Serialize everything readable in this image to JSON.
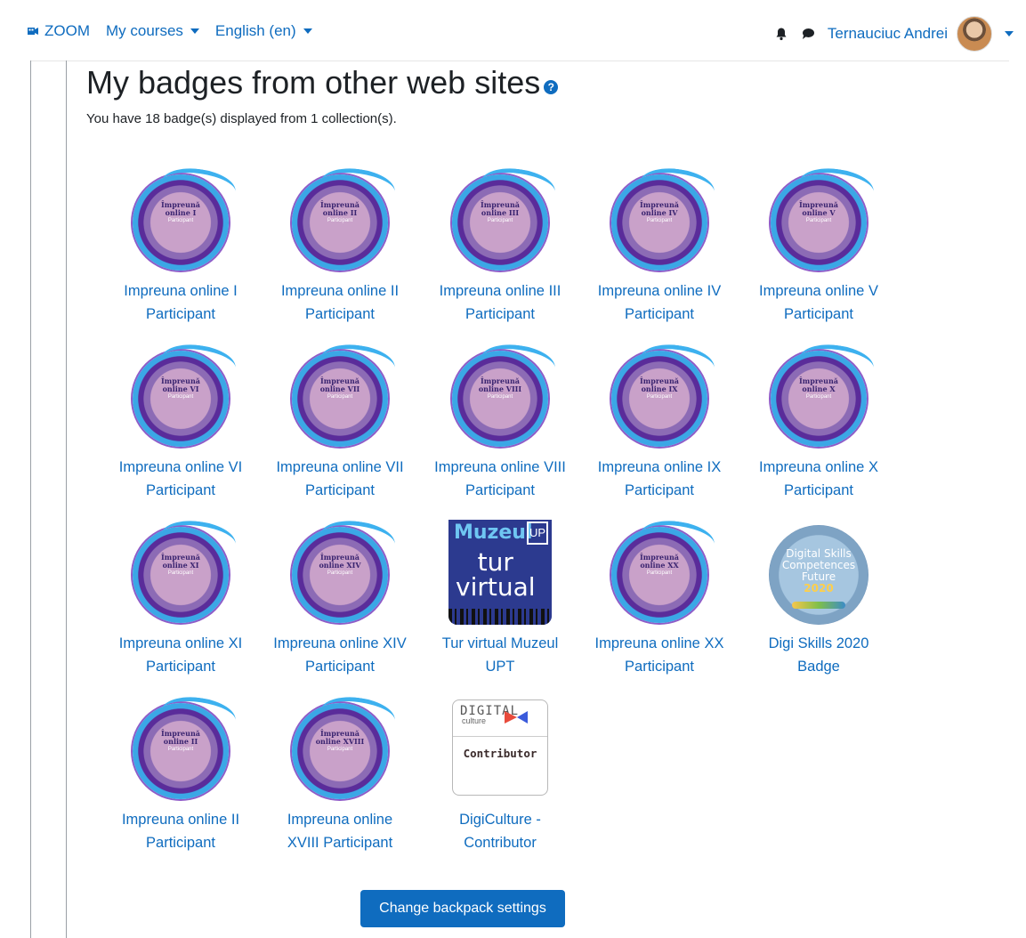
{
  "nav": {
    "zoom_label": "ZOOM",
    "my_courses_label": "My courses",
    "language_label": "English (en)",
    "user_name": "Ternauciuc Andrei"
  },
  "page": {
    "title": "My badges from other web sites",
    "summary": "You have 18 badge(s) displayed from 1 collection(s)."
  },
  "badge_image_text": {
    "impreuna": "Împreună",
    "online_prefix": "online",
    "participant": "Participant",
    "muzeul": "Muzeul",
    "up": "UP",
    "tur": "tur",
    "virtual": "virtual",
    "digital_skills": "Digital Skills",
    "competences": "Competences",
    "future": "Future",
    "year": "2020",
    "digital": "DIGITAL",
    "culture": "culture",
    "contributor": "Contributor"
  },
  "badges": [
    {
      "line1": "Impreuna online I",
      "line2": "Participant",
      "numeral": "I",
      "kind": "circle"
    },
    {
      "line1": "Impreuna online II",
      "line2": "Participant",
      "numeral": "II",
      "kind": "circle"
    },
    {
      "line1": "Impreuna online III",
      "line2": "Participant",
      "numeral": "III",
      "kind": "circle"
    },
    {
      "line1": "Impreuna online IV",
      "line2": "Participant",
      "numeral": "IV",
      "kind": "circle"
    },
    {
      "line1": "Impreuna online V",
      "line2": "Participant",
      "numeral": "V",
      "kind": "circle"
    },
    {
      "line1": "Impreuna online VI",
      "line2": "Participant",
      "numeral": "VI",
      "kind": "circle"
    },
    {
      "line1": "Impreuna online VII",
      "line2": "Participant",
      "numeral": "VII",
      "kind": "circle"
    },
    {
      "line1": "Impreuna online VIII",
      "line2": "Participant",
      "numeral": "VIII",
      "kind": "circle"
    },
    {
      "line1": "Impreuna online IX",
      "line2": "Participant",
      "numeral": "IX",
      "kind": "circle"
    },
    {
      "line1": "Impreuna online X",
      "line2": "Participant",
      "numeral": "X",
      "kind": "circle"
    },
    {
      "line1": "Impreuna online XI",
      "line2": "Participant",
      "numeral": "XI",
      "kind": "circle"
    },
    {
      "line1": "Impreuna online XIV",
      "line2": "Participant",
      "numeral": "XIV",
      "kind": "circle"
    },
    {
      "line1": "Tur virtual Muzeul",
      "line2": "UPT",
      "numeral": "",
      "kind": "muzeul"
    },
    {
      "line1": "Impreuna online XX",
      "line2": "Participant",
      "numeral": "XX",
      "kind": "circle"
    },
    {
      "line1": "Digi Skills 2020",
      "line2": "Badge",
      "numeral": "",
      "kind": "digiskills"
    },
    {
      "line1": "Impreuna online II",
      "line2": "Participant",
      "numeral": "II",
      "kind": "circle"
    },
    {
      "line1": "Impreuna online",
      "line2": "XVIII Participant",
      "numeral": "XVIII",
      "kind": "circle"
    },
    {
      "line1": "DigiCulture -",
      "line2": "Contributor",
      "numeral": "",
      "kind": "digiculture"
    }
  ],
  "actions": {
    "change_backpack_label": "Change backpack settings"
  },
  "colors": {
    "link": "#0f6cbf",
    "button": "#0f6cbf"
  }
}
